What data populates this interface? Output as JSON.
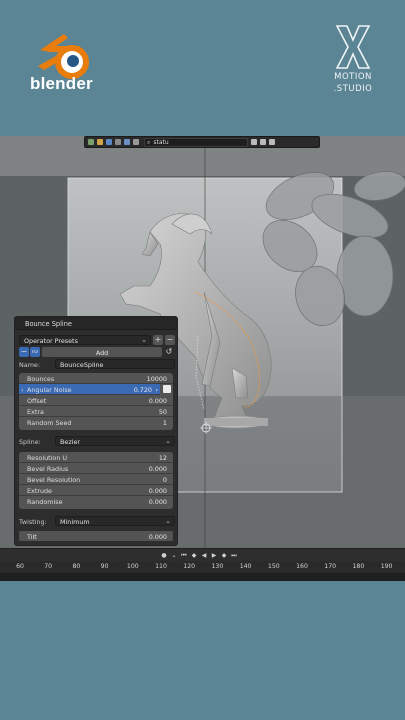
{
  "branding": {
    "blender_word": "blender",
    "studio_line1": "MOTION",
    "studio_line2": ".STUDIO"
  },
  "viewport_header": {
    "search_value": "statu"
  },
  "operator_panel": {
    "title": "Bounce Spline",
    "presets_label": "Operator Presets",
    "add_label": "Add",
    "name_label": "Name:",
    "name_value": "BounceSpline",
    "group1": [
      {
        "label": "Bounces",
        "value": "10000"
      },
      {
        "label": "Angular Noise",
        "value": "0.720"
      },
      {
        "label": "Offset",
        "value": "0.000"
      },
      {
        "label": "Extra",
        "value": "50"
      },
      {
        "label": "Random Seed",
        "value": "1"
      }
    ],
    "spline_label": "Spline:",
    "spline_value": "Bezier",
    "group2": [
      {
        "label": "Resolution U",
        "value": "12"
      },
      {
        "label": "Bevel Radius",
        "value": "0.000"
      },
      {
        "label": "Bevel Resolution",
        "value": "0"
      },
      {
        "label": "Extrude",
        "value": "0.000"
      },
      {
        "label": "Randomise",
        "value": "0.000"
      }
    ],
    "twisting_label": "Twisting:",
    "twisting_value": "Minimum",
    "tilt_label": "Tilt",
    "tilt_value": "0.000"
  },
  "timeline": {
    "frames": [
      "60",
      "70",
      "80",
      "90",
      "100",
      "110",
      "120",
      "130",
      "140",
      "150",
      "160",
      "170",
      "180",
      "190"
    ]
  },
  "colors": {
    "background": "#5b8494",
    "panel": "#2d2d2d",
    "field": "#545454",
    "active": "#3b6ab5",
    "blender_orange": "#e87d0d",
    "blender_blue": "#265787"
  }
}
